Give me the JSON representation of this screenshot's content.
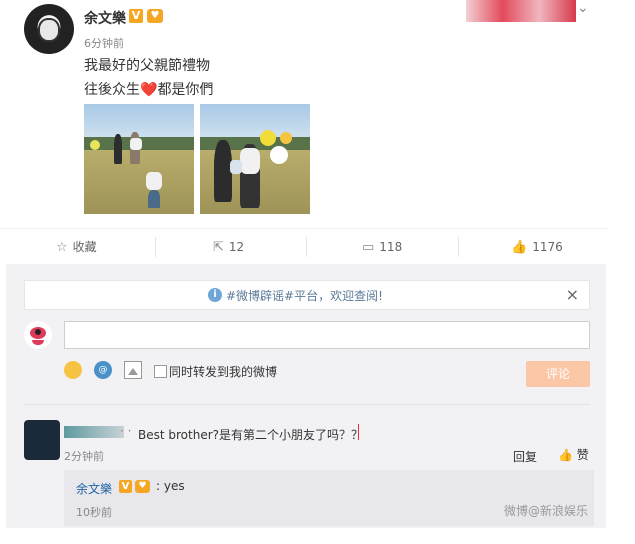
{
  "post": {
    "author": "余文樂",
    "v_badge": "V",
    "fan_badge": "♥",
    "time": "6分钟前",
    "line1": "我最好的父親節禮物",
    "line2_before": "往後众生",
    "line2_heart": "❤️",
    "line2_after": "都是你們"
  },
  "actions": {
    "favorite_label": "收藏",
    "repost_count": "12",
    "comment_count": "118",
    "like_count": "1176"
  },
  "comment_panel": {
    "notice_text": "#微博辟谣#平台，欢迎查阅!",
    "notice_close": "×",
    "topic_icon_text": "@",
    "repost_checkbox_label": "同时转发到我的微博",
    "submit_label": "评论"
  },
  "comments": [
    {
      "dots": "· ·",
      "text": "Best brother?是有第二个小朋友了吗？？",
      "time": "2分钟前",
      "reply_label": "回复",
      "like_label": "赞"
    }
  ],
  "reply": {
    "author": "余文樂",
    "v_badge": "V",
    "fan_badge": "♥",
    "text": ": yes",
    "time": "10秒前",
    "watermark": "微博@新浪娱乐"
  },
  "colors": {
    "accent_orange": "#f5a623",
    "link_blue": "#1f62a5",
    "submit_disabled": "#fbc7a6",
    "panel_bg": "#f2f2f5"
  }
}
